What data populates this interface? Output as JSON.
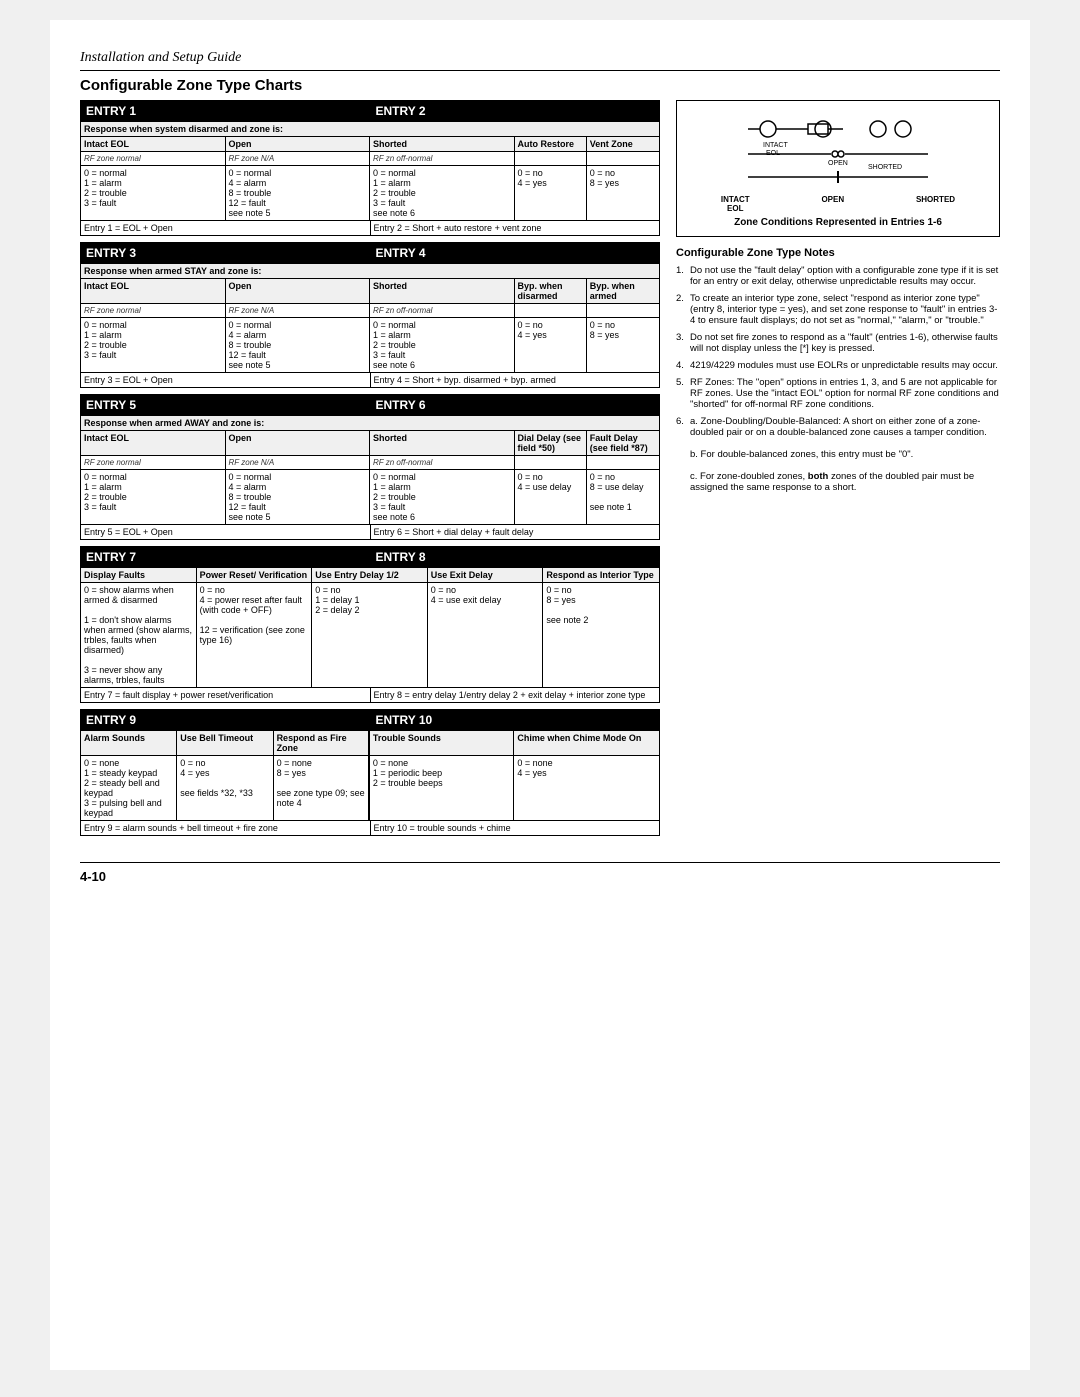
{
  "page": {
    "header": "Installation and Setup Guide",
    "section_title": "Configurable Zone Type Charts",
    "page_number": "4-10"
  },
  "entries": {
    "entry1": {
      "title": "ENTRY 1",
      "subtitle": "Response when system disarmed and zone is:",
      "col1_header": "Intact EOL",
      "col2_header": "Open",
      "col3_header": "Shorted",
      "col4_header": "Auto Restore",
      "col5_header": "Vent Zone",
      "col1_note": "RF zone normal",
      "col2_note": "RF zone N/A",
      "col3_note": "RF zn off-normal",
      "col1_vals": [
        "0 = normal",
        "1 = alarm",
        "2 = trouble",
        "3 = fault"
      ],
      "col2_vals": [
        "0 = normal",
        "4 = alarm",
        "8 = trouble",
        "12 = fault",
        "see note 5"
      ],
      "col3_vals": [
        "0 = normal",
        "1 = alarm",
        "2 = trouble",
        "3 = fault",
        "see note 6"
      ],
      "col4_vals": [
        "0 = no",
        "4 = yes"
      ],
      "col5_vals": [
        "0 = no",
        "8 = yes"
      ],
      "footer": "Entry 1 = EOL + Open"
    },
    "entry2": {
      "title": "ENTRY 2",
      "footer": "Entry 2 = Short + auto restore + vent zone"
    },
    "entry3": {
      "title": "ENTRY 3",
      "subtitle": "Response when armed STAY and zone is:",
      "col4_header": "Byp. when disarmed",
      "col5_header": "Byp. when armed",
      "col4_vals": [
        "0 = no",
        "4 = yes"
      ],
      "col5_vals": [
        "0 = no",
        "8 = yes"
      ],
      "footer": "Entry 3 = EOL + Open"
    },
    "entry4": {
      "title": "ENTRY 4",
      "footer": "Entry 4 = Short + byp. disarmed + byp. armed"
    },
    "entry5": {
      "title": "ENTRY 5",
      "subtitle": "Response when armed AWAY and zone is:",
      "col4_header": "Dial Delay (see field *50)",
      "col5_header": "Fault Delay (see field *87)",
      "col4_vals": [
        "0 = no",
        "4 = use delay"
      ],
      "col5_vals": [
        "0 = no",
        "8 = use delay",
        "",
        "see note 1"
      ],
      "footer": "Entry 5 = EOL + Open"
    },
    "entry6": {
      "title": "ENTRY 6",
      "footer": "Entry 6 = Short + dial delay + fault delay"
    },
    "entry7": {
      "title": "ENTRY 7",
      "cols": [
        "Display Faults",
        "Power Reset/ Verification",
        "Use Entry Delay 1/2",
        "Use Exit Delay",
        "Respond as Interior Type"
      ],
      "col1_vals": [
        "0 = show alarms when armed & disarmed",
        "1 = don't show alarms when armed (show alarms, trbles, faults when disarmed)",
        "3 = never show any alarms, trbles, faults"
      ],
      "col2_vals": [
        "0 = no",
        "4 = power reset after fault (with code + OFF)",
        "12 = verification (see zone type 16)"
      ],
      "col3_vals": [
        "0 = no",
        "1 = delay 1",
        "2 = delay 2"
      ],
      "col4_vals": [
        "0 = no",
        "4 = use exit delay"
      ],
      "col5_vals": [
        "0 = no",
        "8 = yes",
        "",
        "see note 2"
      ],
      "footer": "Entry 7 = fault display + power reset/verification"
    },
    "entry8": {
      "title": "ENTRY 8",
      "footer": "Entry 8 = entry delay 1/entry delay 2 + exit delay + interior zone type"
    },
    "entry9": {
      "title": "ENTRY 9",
      "cols": [
        "Alarm Sounds",
        "Use Bell Timeout",
        "Respond as Fire Zone"
      ],
      "col1_vals": [
        "0 = none",
        "1 = steady keypad",
        "2 = steady bell and keypad",
        "3 = pulsing bell and keypad"
      ],
      "col2_vals": [
        "0 = no",
        "4 = yes",
        "",
        "see fields *32, *33"
      ],
      "col3_vals": [
        "0 = none",
        "8 = yes",
        "",
        "see zone type 09; see note 4"
      ],
      "footer": "Entry 9 = alarm sounds + bell timeout + fire zone"
    },
    "entry10": {
      "title": "ENTRY 10",
      "cols": [
        "Trouble Sounds",
        "Chime when Chime Mode On"
      ],
      "col1_vals": [
        "0 = none",
        "1 = periodic beep",
        "2 = trouble beeps"
      ],
      "col2_vals": [
        "0 = none",
        "4 = yes"
      ],
      "footer": "Entry 10 = trouble sounds + chime"
    }
  },
  "zone_diagram": {
    "title": "Zone Conditions Represented in Entries 1-6",
    "labels": [
      "INTACT EOL",
      "OPEN",
      "SHORTED"
    ]
  },
  "notes": {
    "title": "Configurable Zone Type Notes",
    "items": [
      "Do not use the \"fault delay\" option with a configurable zone type if it is set for an entry or exit delay, otherwise unpredictable results may occur.",
      "To create an interior type zone, select \"respond as interior zone type\" (entry 8, interior type = yes), and set zone response to \"fault\" in entries 3-4 to ensure fault displays; do not set as \"normal,\" \"alarm,\" or \"trouble.\"",
      "Do not set fire zones to respond as a \"fault\" (entries 1-6), otherwise faults will not display unless the [*] key is pressed.",
      "4219/4229 modules must use EOLRs or unpredictable results may occur.",
      "RF Zones: The \"open\" options in entries 1, 3, and 5 are not applicable for RF zones. Use the \"intact EOL\" option for normal RF zone conditions and \"shorted\" for off-normal RF zone conditions.",
      "a. Zone-Doubling/Double-Balanced: A short on either zone of a zone-doubled pair or on a double-balanced zone causes a tamper condition.\nb. For double-balanced zones, this entry must be \"0\".\nc. For zone-doubled zones, both zones of the doubled pair must be assigned the same response to a short."
    ]
  }
}
